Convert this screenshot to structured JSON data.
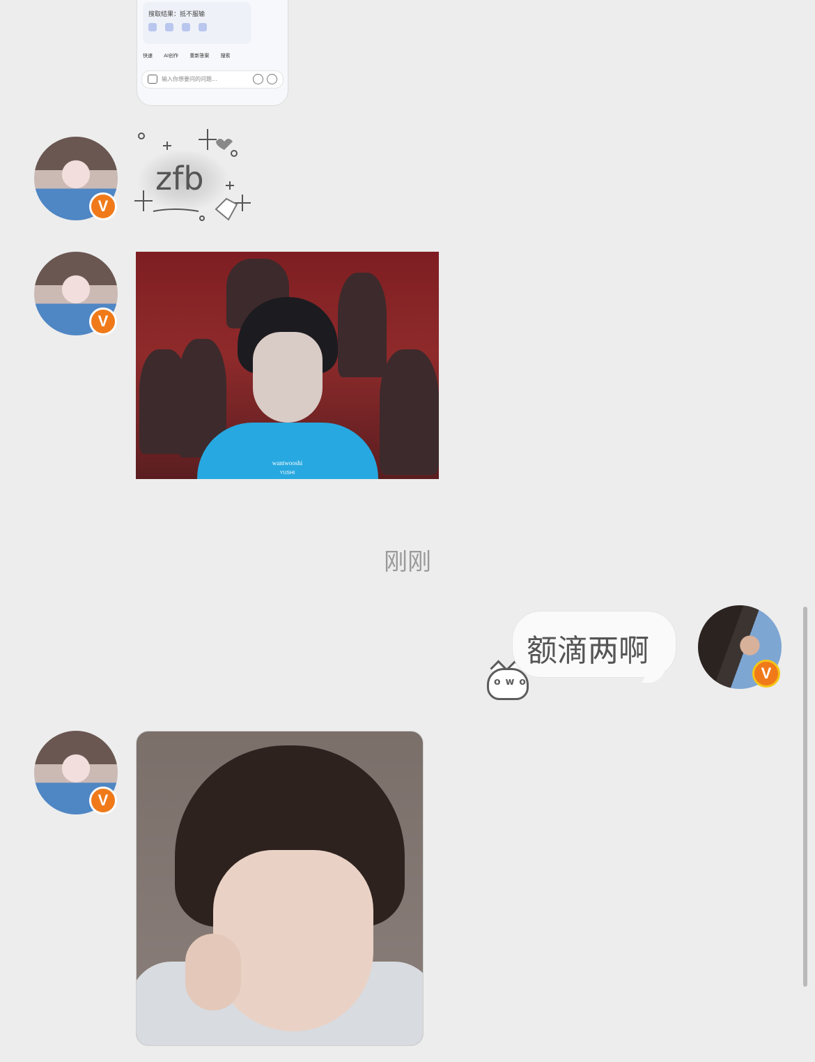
{
  "top_screenshot": {
    "result_line": "搜取结果：抵不服输",
    "tools": [
      "快速",
      "AI创作",
      "重新答案",
      "搜索"
    ],
    "input_placeholder": "输入你想要问的问题..."
  },
  "messages": [
    {
      "sender": "other",
      "type": "sticker",
      "text": "zfb"
    },
    {
      "sender": "other",
      "type": "image",
      "watermark_line1": "wantwooshi",
      "watermark_line2": "YUSHI"
    },
    {
      "type": "timestamp",
      "text": "刚刚"
    },
    {
      "sender": "me",
      "type": "text",
      "text": "额滴两啊"
    },
    {
      "sender": "other",
      "type": "image"
    }
  ],
  "cat_face": "o w o",
  "verified_badge": "V",
  "colors": {
    "background": "#ededed",
    "badge_orange": "#f07a1a",
    "bubble": "#fafafa",
    "timestamp": "#9a9a9a"
  }
}
